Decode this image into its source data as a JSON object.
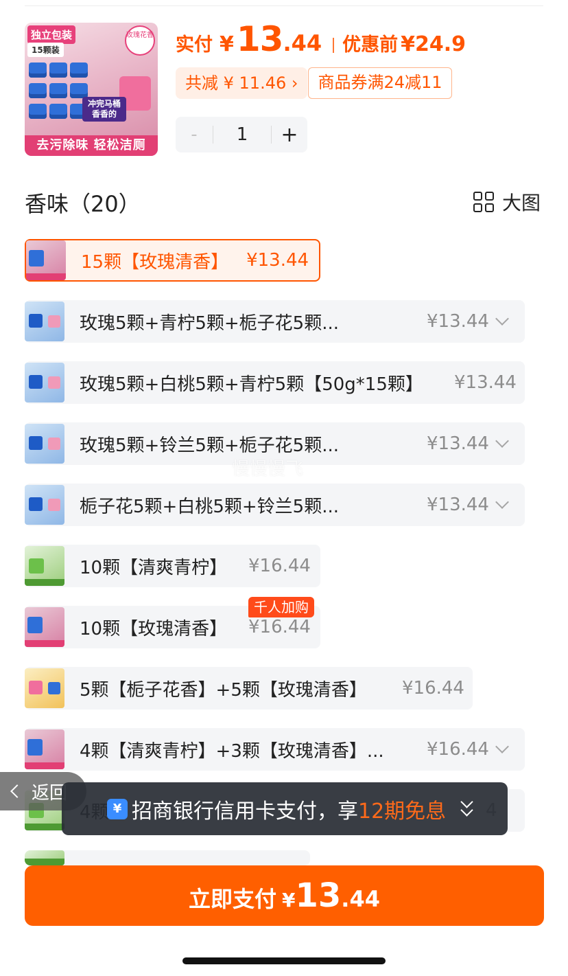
{
  "product": {
    "image_tags": {
      "top_left": "独立包装",
      "count": "15颗装",
      "seal": "玫瑰花香",
      "middle": "冲完马桶香香的",
      "bottom": "去污除味 轻松洁厕"
    },
    "paid_label": "实付",
    "currency": "¥",
    "paid_int": "13",
    "paid_dec": ".44",
    "before_label": "优惠前",
    "before_price": "¥24.9",
    "discount_total": "共减 ¥ 11.46 ›",
    "coupon": "商品券满24减11",
    "quantity": "1",
    "minus": "-",
    "plus": "+"
  },
  "section": {
    "title": "香味（20）",
    "big_view_label": "大图"
  },
  "skus": [
    {
      "name": "15颗【玫瑰清香】",
      "price": "¥13.44",
      "selected": true
    },
    {
      "name": "玫瑰5颗+青柠5颗+栀子花5颗...",
      "price": "¥13.44"
    },
    {
      "name": "玫瑰5颗+白桃5颗+青柠5颗【50g*15颗】",
      "price": "¥13.44"
    },
    {
      "name": "玫瑰5颗+铃兰5颗+栀子花5颗...",
      "price": "¥13.44"
    },
    {
      "name": "栀子花5颗+白桃5颗+铃兰5颗...",
      "price": "¥13.44"
    },
    {
      "name": "10颗【清爽青柠】",
      "price": "¥16.44"
    },
    {
      "name": "10颗【玫瑰清香】",
      "price": "¥16.44",
      "tag": "千人加购"
    },
    {
      "name": "5颗【栀子花香】+5颗【玫瑰清香】",
      "price": "¥16.44"
    },
    {
      "name": "4颗【清爽青柠】+3颗【玫瑰清香】...",
      "price": "¥16.44"
    },
    {
      "name": "4颗",
      "price": "4"
    }
  ],
  "watermark": "慢慢慢飞",
  "back": {
    "label": "返回"
  },
  "bank_banner": {
    "text": "招商银行信用卡支付，享",
    "highlight": "12期免息",
    "icon": "¥"
  },
  "pay_button": {
    "label": "立即支付",
    "currency": "¥",
    "int": "13",
    "dec": ".44"
  },
  "colors": {
    "accent": "#ff5500",
    "button": "#ff5f00",
    "banner_bg": "#282c34"
  }
}
